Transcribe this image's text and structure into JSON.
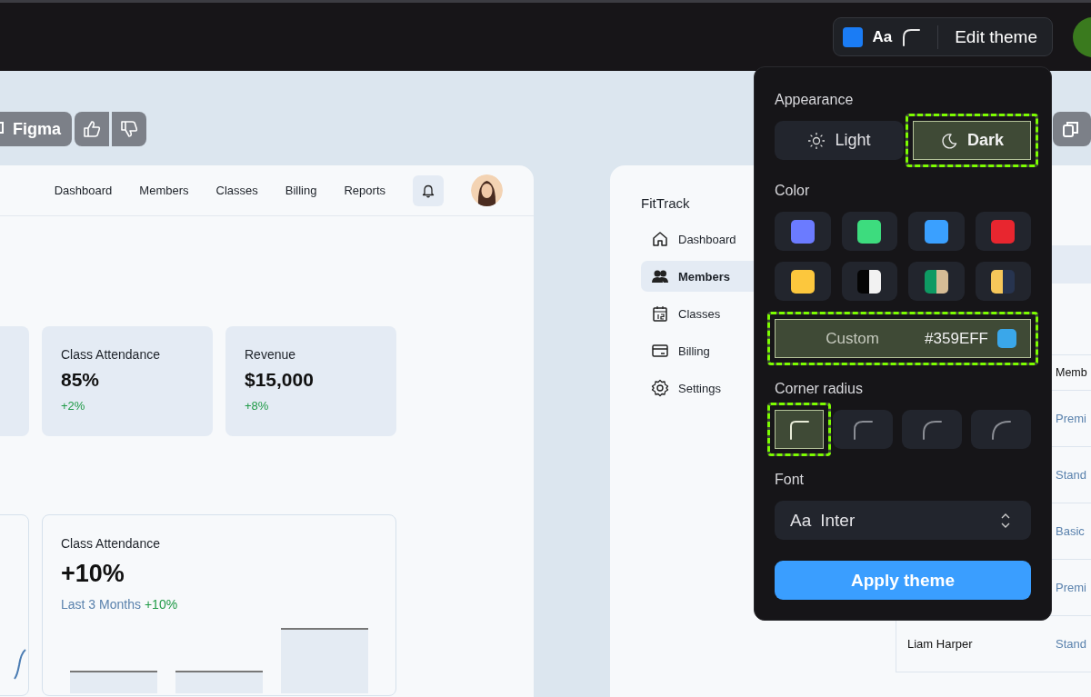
{
  "top_bar": {
    "theme_button": {
      "color": "#1a7cf5",
      "font_sample": "Aa",
      "label": "Edit theme"
    }
  },
  "left_frame": {
    "toolbar": {
      "figma_button": "Figma"
    },
    "nav": [
      "Dashboard",
      "Members",
      "Classes",
      "Billing",
      "Reports"
    ],
    "stats": [
      {
        "title": "Class Attendance",
        "value": "85%",
        "delta": "+2%"
      },
      {
        "title": "Revenue",
        "value": "$15,000",
        "delta": "+8%"
      }
    ],
    "chart_card": {
      "title": "Class Attendance",
      "value": "+10%",
      "period": "Last 3 Months",
      "delta": "+10%"
    }
  },
  "right_frame": {
    "brand": "FitTrack",
    "sidebar": {
      "items": [
        {
          "label": "Dashboard",
          "kind": "home",
          "selected": false
        },
        {
          "label": "Members",
          "kind": "members",
          "selected": true
        },
        {
          "label": "Classes",
          "kind": "calendar",
          "selected": false
        },
        {
          "label": "Billing",
          "kind": "card",
          "selected": false
        },
        {
          "label": "Settings",
          "kind": "gear",
          "selected": false
        }
      ]
    },
    "table": {
      "header": "Memb",
      "rows": [
        {
          "column_2": "Premi"
        },
        {
          "column_2": "Stand"
        },
        {
          "column_2": "Basic"
        },
        {
          "column_2": "Premi"
        },
        {
          "name": "Liam Harper",
          "column_2": "Stand"
        }
      ]
    }
  },
  "theme_popover": {
    "appearance": {
      "title": "Appearance",
      "options": [
        {
          "label": "Light",
          "kind": "sun",
          "selected": false
        },
        {
          "label": "Dark",
          "kind": "moon",
          "selected": true
        }
      ]
    },
    "color": {
      "title": "Color",
      "swatches": [
        {
          "color": "#6b7bff",
          "selected": false
        },
        {
          "color": "#3ddc7e",
          "selected": false
        },
        {
          "color": "#3aa0ff",
          "selected": false
        },
        {
          "color": "#e8262f",
          "selected": false
        },
        {
          "color": "#fcc73d",
          "selected": false
        },
        {
          "halves": [
            {
              "color": "#050505"
            },
            {
              "color": "#f2f2f2"
            }
          ],
          "selected": false
        },
        {
          "halves": [
            {
              "color": "#0e9a63"
            },
            {
              "color": "#d6bc95"
            }
          ],
          "selected": false
        },
        {
          "halves": [
            {
              "color": "#f6c75a"
            },
            {
              "color": "#27344f"
            }
          ],
          "selected": false
        }
      ],
      "custom": {
        "label": "Custom",
        "value": "#359EFF",
        "color": "#3aa7ea",
        "selected": true
      }
    },
    "corner_radius": {
      "title": "Corner radius",
      "options": [
        {
          "selected": true
        },
        {
          "selected": false
        },
        {
          "selected": false
        },
        {
          "selected": false
        }
      ]
    },
    "font": {
      "title": "Font",
      "sample": "Aa",
      "value": "Inter"
    },
    "apply_button": "Apply theme"
  }
}
